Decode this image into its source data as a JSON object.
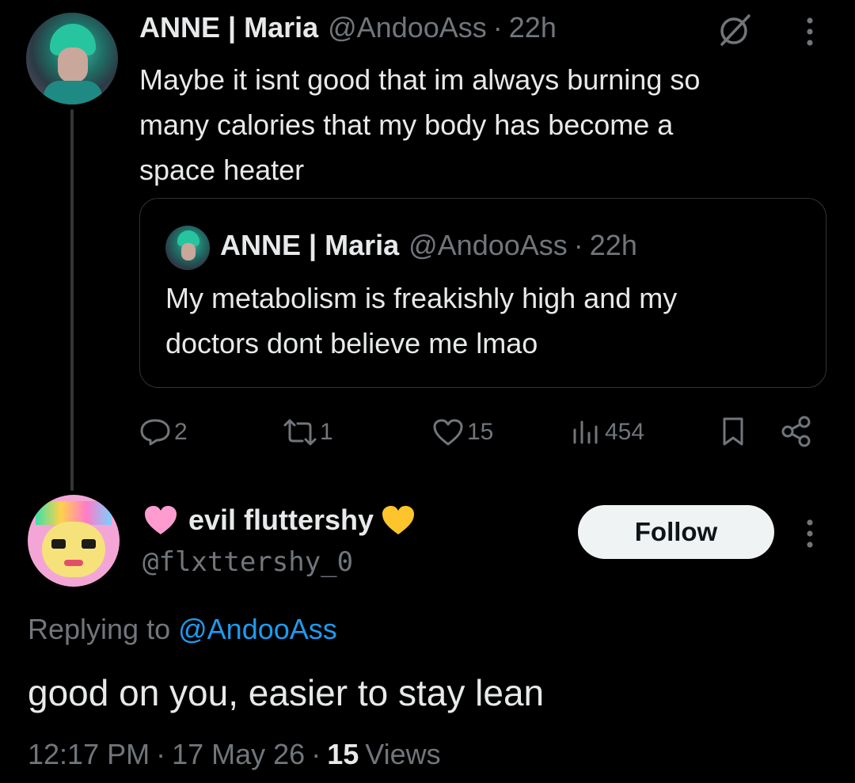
{
  "parent_tweet": {
    "display_name": "ANNE | Maria",
    "handle": "@AndooAss",
    "separator": "·",
    "time": "22h",
    "text_lines": [
      "Maybe it isnt good that im always burning so",
      "many calories that my body has become a",
      "space heater"
    ],
    "quoted": {
      "display_name": "ANNE | Maria",
      "handle": "@AndooAss",
      "separator": "·",
      "time": "22h",
      "text_lines": [
        "My metabolism is freakishly high and my",
        "doctors dont believe me lmao"
      ]
    },
    "metrics": {
      "replies": "2",
      "reposts": "1",
      "likes": "15",
      "views": "454"
    }
  },
  "reply_tweet": {
    "emoji_left": "🩷",
    "display_name": "evil fluttershy",
    "emoji_right": "💛",
    "handle": "@flxttershy_0",
    "follow_label": "Follow",
    "replying_prefix": "Replying to",
    "replying_to": "@AndooAss",
    "text": "good on you, easier to stay lean",
    "timestamp": "12:17 PM",
    "date": "17 May 26",
    "separator": "·",
    "views_count": "15",
    "views_label": "Views"
  },
  "colors": {
    "background": "#000000",
    "text_primary": "#e7e9ea",
    "text_secondary": "#71767b",
    "link": "#1d9bf0",
    "follow_bg": "#eff3f4"
  }
}
